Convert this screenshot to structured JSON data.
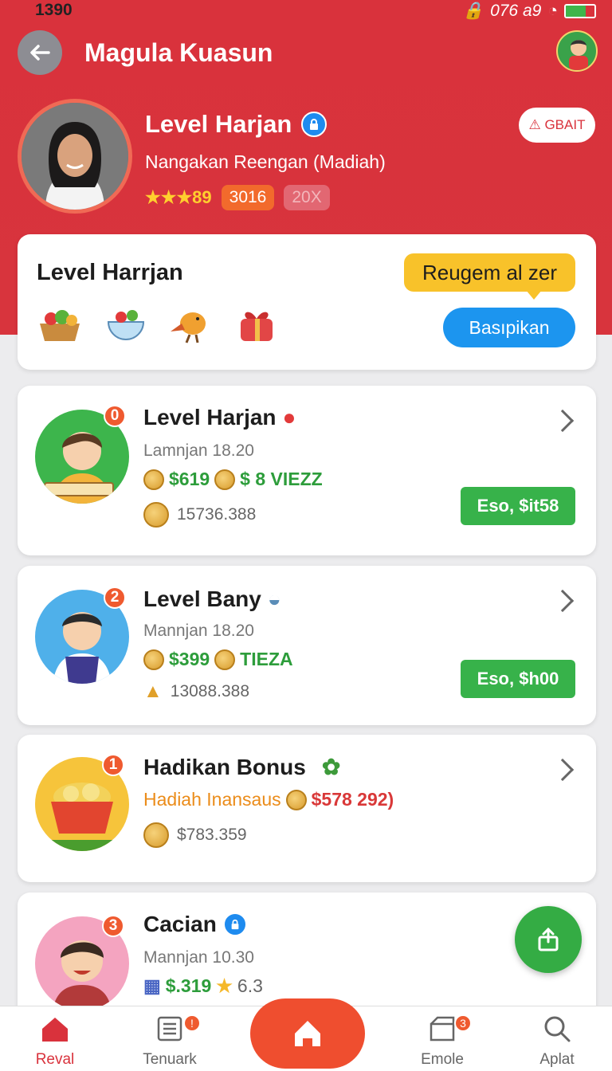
{
  "status": {
    "time": "1390",
    "info": "076 a9"
  },
  "header": {
    "title": "Magula Kuasun"
  },
  "profile": {
    "name": "Level Harjan",
    "subtitle": "Nangakan Reengan (Madiah)",
    "stars": "★★★89",
    "badge_primary": "3016",
    "badge_secondary": "20X",
    "action_label": "⚠ GBAIT"
  },
  "reward": {
    "title": "Level Harrjan",
    "tooltip": "Reugem al zer",
    "button": "Basıpikan",
    "foods": [
      "basket-icon",
      "bowl-icon",
      "bird-icon",
      "gift-icon"
    ]
  },
  "items": [
    {
      "rank": "0",
      "title": "Level Harjan",
      "subtitle": "Lamnjan 18.20",
      "price": "$619",
      "tag": "$ 8 VIEZZ",
      "meta": "15736.388",
      "action": "Eso, $it58"
    },
    {
      "rank": "2",
      "title": "Level Bany",
      "subtitle": "Mannjan 18.20",
      "price": "$399",
      "tag": "TIEZA",
      "meta": "13088.388",
      "action": "Eso, $h00"
    },
    {
      "rank": "1",
      "title": "Hadikan Bonus",
      "subtitle": "Hadiah Inansaus",
      "price": "$578 292)",
      "meta": "$783.359"
    },
    {
      "rank": "3",
      "title": "Cacian",
      "subtitle": "Mannjan 10.30",
      "price": "$.319",
      "tag": "6.3"
    }
  ],
  "nav": {
    "items": [
      {
        "label": "Reval"
      },
      {
        "label": "Tenuark",
        "badge": "!"
      },
      {
        "label": "Emole",
        "badge": "3"
      },
      {
        "label": "Aplat"
      }
    ]
  },
  "colors": {
    "accent": "#d9323c",
    "green": "#37b24a",
    "blue": "#1c95ef",
    "yellow": "#f8c22a"
  }
}
